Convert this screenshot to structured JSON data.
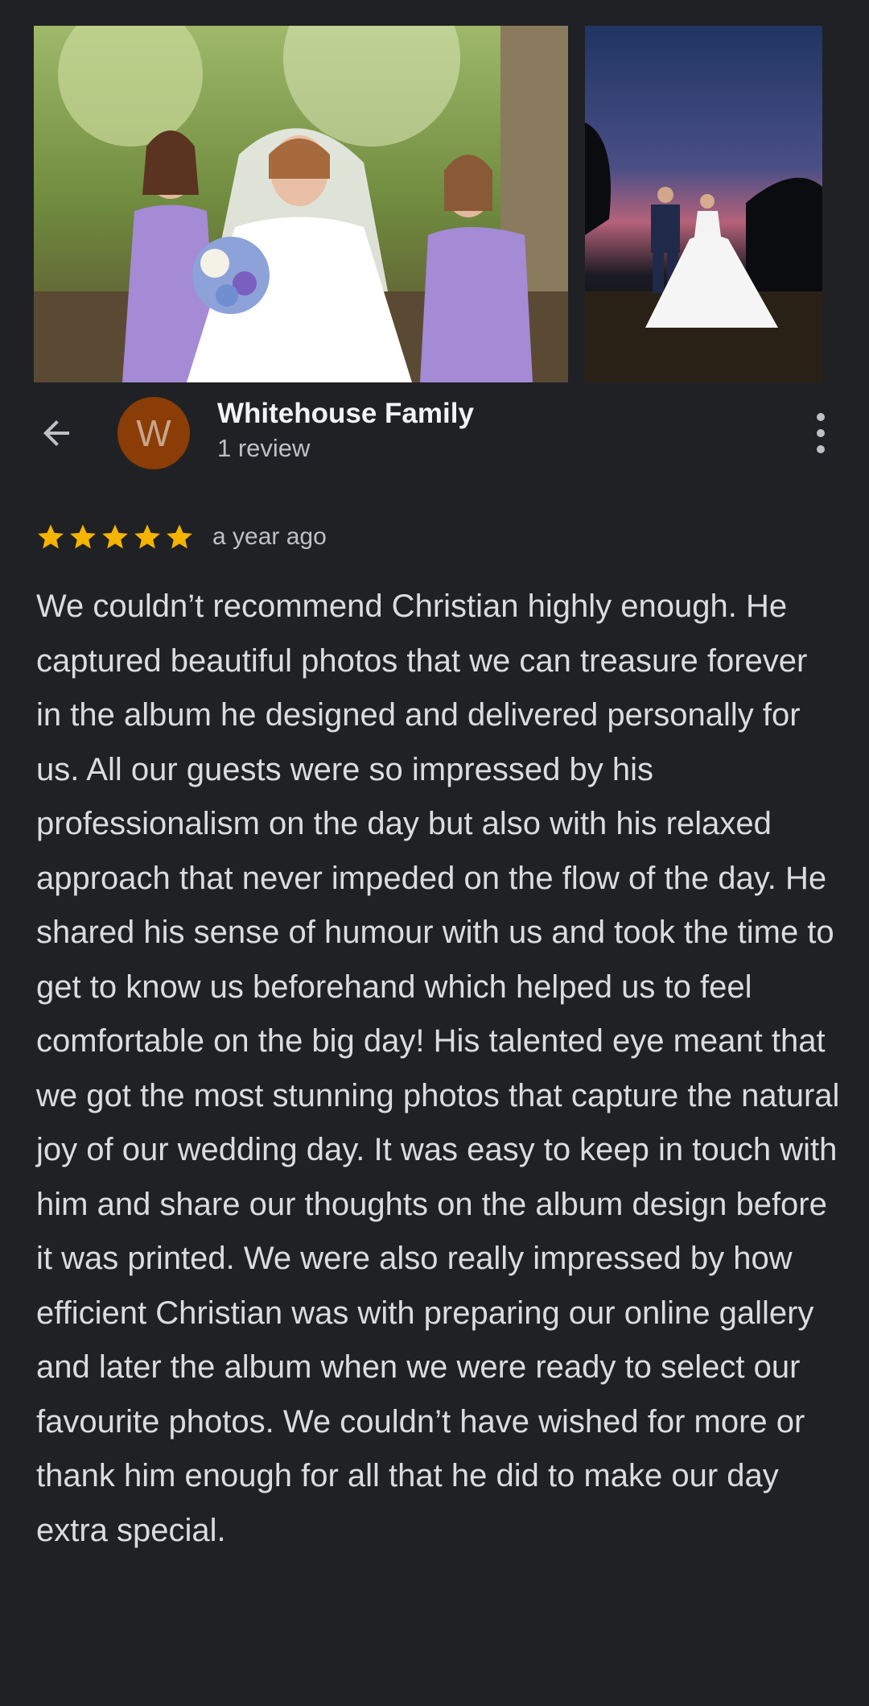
{
  "photos": [
    {
      "alt_icon": "photo-bride-bridesmaids"
    },
    {
      "alt_icon": "photo-couple-night"
    }
  ],
  "reviewer": {
    "avatar_letter": "W",
    "avatar_color": "#8a3d06",
    "name": "Whitehouse Family",
    "review_count": "1 review"
  },
  "icons": {
    "back": "arrow-back-icon",
    "more": "more-vert-icon",
    "star": "star-icon"
  },
  "review": {
    "rating": 5,
    "star_color": "#f4b400",
    "time": "a year ago",
    "text": "We couldn’t recommend Christian highly enough. He captured beautiful photos that we can treasure forever in the album he designed and delivered personally for us. All our guests were so impressed by his professionalism on the day but also with his relaxed approach that never impeded on the flow of the day. He shared his sense of humour with us and took the time to get to know us beforehand which helped us to feel comfortable on the big day! His talented eye meant that we got the most stunning photos that capture the natural joy of our wedding day. It was easy to keep in touch with him and share our thoughts on the album design before it was printed. We were also really impressed by how efficient Christian was with preparing our online gallery and later the album when we were ready to select our favourite photos. We couldn’t have wished for more or thank him enough for all that he did to make our day extra special."
  }
}
